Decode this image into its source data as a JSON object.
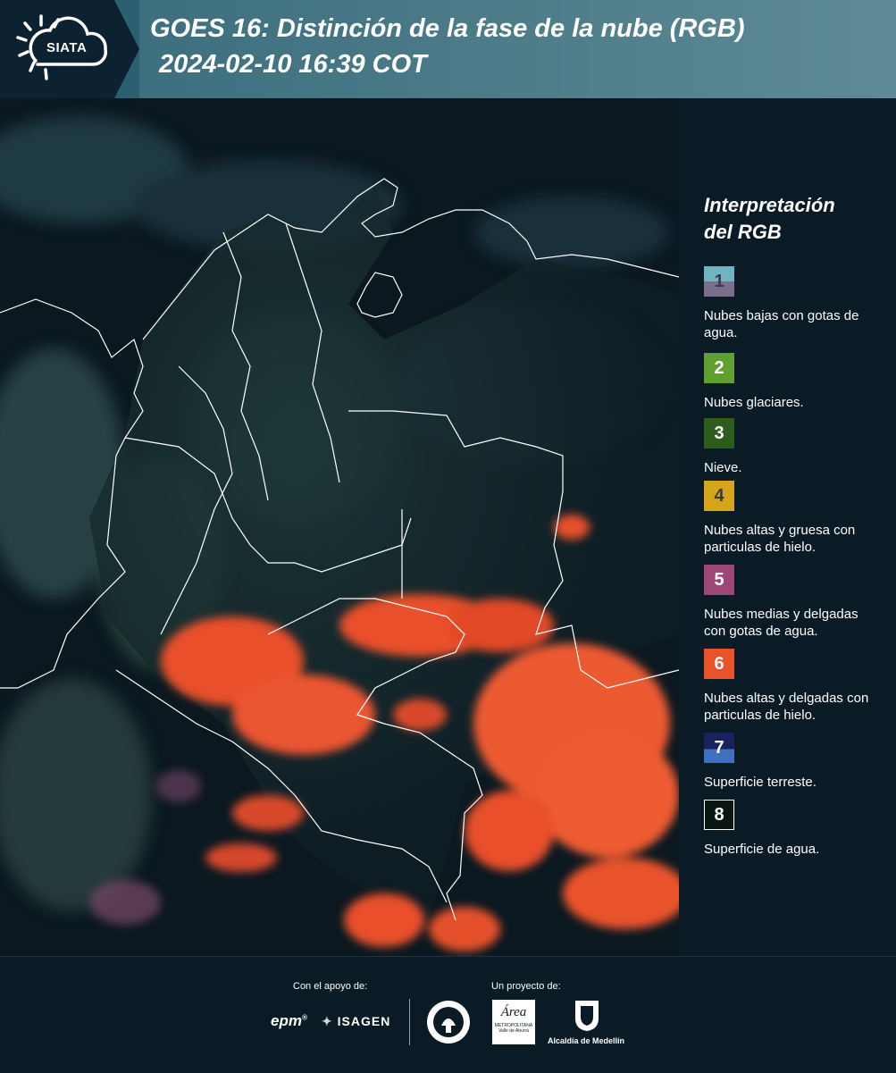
{
  "header": {
    "logo_text": "SIATA",
    "title_line1": "GOES 16: Distinción de la fase de la nube (RGB)",
    "title_line2": "2024-02-10 16:39 COT"
  },
  "legend": {
    "title_line1": "Interpretación",
    "title_line2": "del RGB",
    "items": [
      {
        "number": "1",
        "label": "Nubes bajas con gotas de agua.",
        "color_top": "#6fb4c0",
        "color_bottom": "#7a6f8b"
      },
      {
        "number": "2",
        "label": "Nubes glaciares.",
        "color": "#5fa031"
      },
      {
        "number": "3",
        "label": "Nieve.",
        "color": "#2e5c1c"
      },
      {
        "number": "4",
        "label": "Nubes altas y gruesa con particulas de hielo.",
        "color": "#d6a51b"
      },
      {
        "number": "5",
        "label": "Nubes medias y delgadas con gotas de agua.",
        "color": "#9c4778"
      },
      {
        "number": "6",
        "label": "Nubes altas y delgadas con particulas de hielo.",
        "color": "#e8532a"
      },
      {
        "number": "7",
        "label": "Superficie terreste.",
        "color_top": "#17235a",
        "color_bottom": "#4070c0"
      },
      {
        "number": "8",
        "label": "Superficie de agua.",
        "color": "#0a160f"
      }
    ]
  },
  "footer": {
    "support_label": "Con el apoyo de:",
    "project_label": "Un proyecto de:",
    "brand_epm": "epm",
    "brand_isagen": "ISAGEN",
    "brand_area_line1": "Área",
    "brand_area_line2": "METROPOLITANA",
    "brand_area_line3": "Valle de Aburrá",
    "brand_alcaldia": "Alcaldía de Medellín"
  }
}
